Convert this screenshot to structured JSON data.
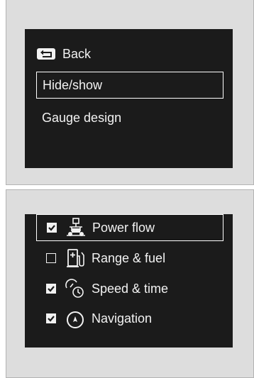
{
  "menu": {
    "back_label": "Back",
    "hide_show_label": "Hide/show",
    "gauge_design_label": "Gauge design"
  },
  "hide_show_list": {
    "items": [
      {
        "label": "Power flow",
        "checked": true,
        "icon": "power-flow-icon",
        "selected": true
      },
      {
        "label": "Range & fuel",
        "checked": false,
        "icon": "fuel-pump-icon",
        "selected": false
      },
      {
        "label": "Speed & time",
        "checked": true,
        "icon": "speed-time-icon",
        "selected": false
      },
      {
        "label": "Navigation",
        "checked": true,
        "icon": "navigation-icon",
        "selected": false
      }
    ]
  },
  "colors": {
    "screen_background": "#1b1b1b",
    "text": "#f2f2f2",
    "panel_background": "#dddddd"
  }
}
